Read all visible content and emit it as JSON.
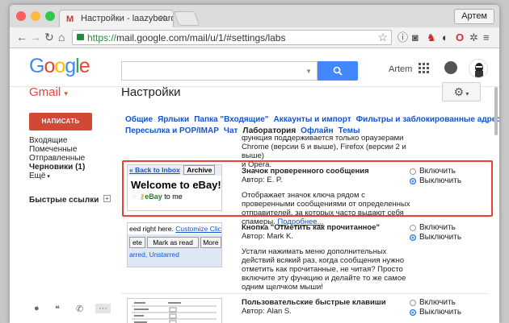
{
  "browser": {
    "tab_title": "Настройки - laazybeard@",
    "tab_icon": "gmail-m-icon",
    "profile_name": "Артем",
    "url_scheme": "https://",
    "url_rest": "mail.google.com/mail/u/1/#settings/labs"
  },
  "header": {
    "logo": "Google",
    "user_name": "Artem",
    "search_placeholder": ""
  },
  "app": {
    "gmail_label": "Gmail",
    "page_title": "Настройки",
    "compose_label": "НАПИСАТЬ",
    "sidebar_items": [
      {
        "label": "Входящие",
        "bold": false
      },
      {
        "label": "Помеченные",
        "bold": false
      },
      {
        "label": "Отправленные",
        "bold": false
      },
      {
        "label": "Черновики (1)",
        "bold": true
      },
      {
        "label": "Ещё",
        "bold": false
      }
    ],
    "quick_links": "Быстрые ссылки"
  },
  "settings_tabs": [
    {
      "label": "Общие",
      "active": false
    },
    {
      "label": "Ярлыки",
      "active": false
    },
    {
      "label": "Папка \"Входящие\"",
      "active": false
    },
    {
      "label": "Аккаунты и импорт",
      "active": false
    },
    {
      "label": "Фильтры и заблокированные адреса",
      "active": false
    },
    {
      "label": "Пересылка и POP/IMAP",
      "active": false
    },
    {
      "label": "Чат",
      "active": false
    },
    {
      "label": "Лаборатория",
      "active": true
    },
    {
      "label": "Офлайн",
      "active": false
    },
    {
      "label": "Темы",
      "active": false
    }
  ],
  "labs": {
    "prev_tail": [
      "функция поддерживается только браузерами",
      "Chrome (версии 6 и выше), Firefox (версии 2 и выше)",
      "и Opera."
    ],
    "items": [
      {
        "title": "Значок проверенного сообщения",
        "author": "Автор: E. P.",
        "description": "Отображает значок ключа рядом с проверенными сообщениями от определенных отправителей, за которых часто выдают себя спамеры.",
        "more_link": "Подробнее...",
        "enable": "Включить",
        "disable": "Выключить",
        "selected": "disable",
        "thumb": {
          "back": "« Back to Inbox",
          "archive": "Archive",
          "welcome": "Welcome to eBay!",
          "ebay": "eBay",
          "to_me": "to me"
        }
      },
      {
        "title": "Кнопка \"Отметить как прочитанное\"",
        "author": "Автор: Mark K.",
        "description": "Устали нажимать меню дополнительных действий всякий раз, когда сообщения нужно отметить как прочитанные, не читая? Просто включите эту функцию и делайте то же самое одним щелчком мыши!",
        "more_link": "",
        "enable": "Включить",
        "disable": "Выключить",
        "selected": "disable",
        "thumb": {
          "line1": "eed right here.",
          "customize": "Customize Clic",
          "b1": "ete",
          "b2": "Mark as read",
          "b3": "More",
          "line3": "arred, Unstarred"
        }
      },
      {
        "title": "Пользовательские быстрые клавиши",
        "author": "Автор: Alan S.",
        "description": "",
        "more_link": "",
        "enable": "Включить",
        "disable": "Выключить",
        "selected": "disable"
      }
    ]
  },
  "colors": {
    "accent_blue": "#4387fd",
    "compose_red": "#d14836",
    "highlight_red": "#ea4335",
    "link_blue": "#1155cc"
  }
}
